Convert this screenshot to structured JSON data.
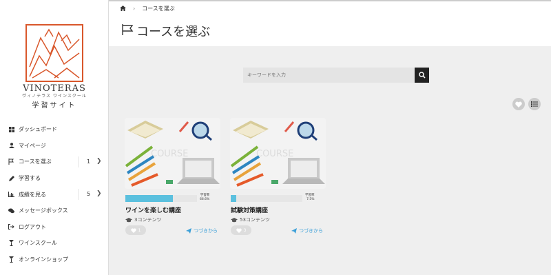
{
  "brand": {
    "name": "VINOTERAS",
    "subtitle": "ヴィノテラス ワインスクール",
    "site": "学習サイト",
    "logo_color": "#d9572b"
  },
  "sidebar": {
    "items": [
      {
        "label": "ダッシュボード",
        "icon": "dashboard-icon"
      },
      {
        "label": "マイページ",
        "icon": "user-icon"
      },
      {
        "label": "コースを選ぶ",
        "icon": "flag-icon",
        "count": "1"
      },
      {
        "label": "学習する",
        "icon": "pencil-icon"
      },
      {
        "label": "成績を見る",
        "icon": "bar-chart-icon",
        "count": "5"
      },
      {
        "label": "メッセージボックス",
        "icon": "comments-icon"
      },
      {
        "label": "ログアウト",
        "icon": "sign-out-icon"
      },
      {
        "label": "ワインスクール",
        "icon": "wine-glass-icon"
      },
      {
        "label": "オンラインショップ",
        "icon": "wine-glass-icon"
      }
    ]
  },
  "breadcrumb": {
    "current": "コースを選ぶ",
    "home_icon": "home-icon"
  },
  "page": {
    "title": "コースを選ぶ"
  },
  "search": {
    "placeholder": "キーワードを入力"
  },
  "courses": [
    {
      "title": "ワインを楽しむ講座",
      "contents": "3コンテンツ",
      "progress_label": "学習率",
      "progress_value": "66.6%",
      "progress": 0.666,
      "likes": "1",
      "continue": "つづきから",
      "thumb_text": "COURSE"
    },
    {
      "title": "試験対策講座",
      "contents": "53コンテンツ",
      "progress_label": "学習率",
      "progress_value": "7.5%",
      "progress": 0.075,
      "likes": "3",
      "continue": "つづきから",
      "thumb_text": "COURSE"
    }
  ],
  "colors": {
    "accent": "#5bc0de",
    "link": "#3a9fd8"
  }
}
